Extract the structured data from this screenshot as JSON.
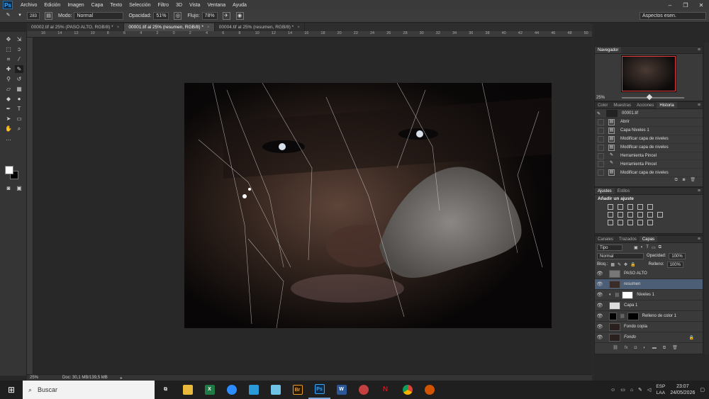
{
  "app": {
    "logo": "Ps"
  },
  "menu": [
    "Archivo",
    "Edición",
    "Imagen",
    "Capa",
    "Texto",
    "Selección",
    "Filtro",
    "3D",
    "Vista",
    "Ventana",
    "Ayuda"
  ],
  "options": {
    "brush_size": "283",
    "mode_label": "Modo:",
    "mode_value": "Normal",
    "opacity_label": "Opacidad:",
    "opacity_value": "51%",
    "flow_label": "Flujo:",
    "flow_value": "78%",
    "workspace": "Aspectos esen."
  },
  "tabs": [
    {
      "label": "00002.tif al 25% (PASO ALTO, RGB/8) *"
    },
    {
      "label": "00001.tif al 25% (resumen, RGB/8) *"
    },
    {
      "label": "00004.tif al 25% (resumen, RGB/8) *"
    }
  ],
  "ruler_h": [
    "16",
    "14",
    "12",
    "10",
    "8",
    "6",
    "4",
    "2",
    "0",
    "2",
    "4",
    "6",
    "8",
    "10",
    "12",
    "14",
    "16",
    "18",
    "20",
    "22",
    "24",
    "26",
    "28",
    "30",
    "32",
    "34",
    "36",
    "38",
    "40",
    "42",
    "44",
    "46",
    "48",
    "50"
  ],
  "status": {
    "zoom": "25%",
    "doc": "Doc: 30,1 MB/139,5 MB"
  },
  "navigator": {
    "title": "Navegador",
    "zoom": "25%"
  },
  "history_panel": {
    "tabs": [
      "Color",
      "Muestras",
      "Acciones",
      "Historia"
    ],
    "snapshot": "00001.tif",
    "steps": [
      "Abrir",
      "Capa Niveles 1",
      "Modificar capa de niveles",
      "Modificar capa de niveles",
      "Herramienta Pincel",
      "Herramienta Pincel",
      "Modificar capa de niveles"
    ]
  },
  "adjust_panel": {
    "tabs": [
      "Ajustes",
      "Estilos"
    ],
    "title": "Añadir un ajuste"
  },
  "layers_panel": {
    "tabs": [
      "Canales",
      "Trazados",
      "Capas"
    ],
    "filter": "Tipo",
    "blend_mode": "Normal",
    "opacity_label": "Opacidad:",
    "opacity_value": "100%",
    "lock_label": "Bloq.:",
    "fill_label": "Relleno:",
    "fill_value": "100%",
    "layers": [
      {
        "name": "PASO ALTO"
      },
      {
        "name": "resumen"
      },
      {
        "name": "Niveles 1"
      },
      {
        "name": "Capa 1"
      },
      {
        "name": "Relleno de color 1"
      },
      {
        "name": "Fondo copia"
      },
      {
        "name": "Fondo"
      }
    ]
  },
  "taskbar": {
    "search_placeholder": "Buscar",
    "lang": "ESP",
    "lang2": "LAA",
    "time": "23:07",
    "date": "24/05/2026"
  }
}
